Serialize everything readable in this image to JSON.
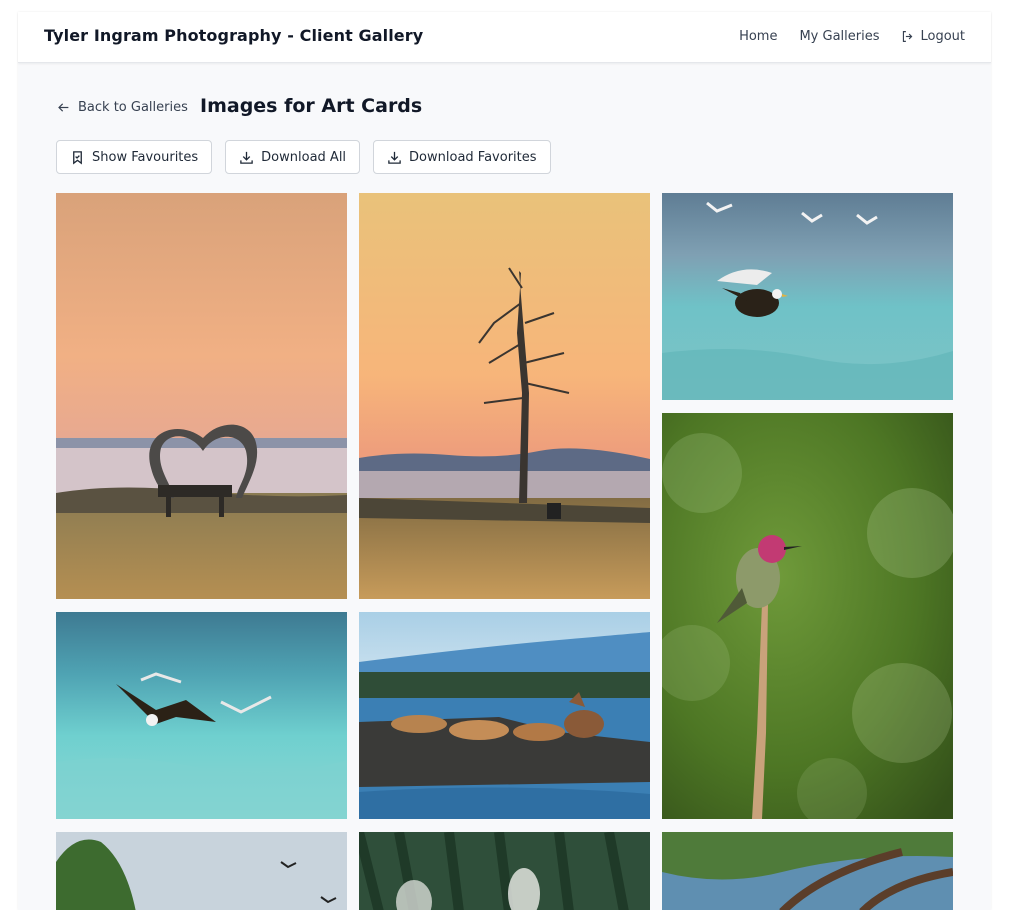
{
  "header": {
    "brand": "Tyler Ingram Photography - Client Gallery",
    "nav": {
      "home": "Home",
      "galleries": "My Galleries",
      "logout": "Logout"
    }
  },
  "page": {
    "back_label": "Back to Galleries",
    "title": "Images for Art Cards"
  },
  "toolbar": {
    "show_favourites": "Show Favourites",
    "download_all": "Download All",
    "download_favorites": "Download Favorites"
  },
  "gallery": {
    "photos": [
      {
        "subject": "driftwood heart and bench at sunset"
      },
      {
        "subject": "bare dead tree at sunset"
      },
      {
        "subject": "bald eagle with gulls over sea"
      },
      {
        "subject": "anna's hummingbird on branch"
      },
      {
        "subject": "bald eagle over turquoise water"
      },
      {
        "subject": "sea lions on rock"
      },
      {
        "subject": "birds over trees"
      },
      {
        "subject": "whale spouts by forest"
      },
      {
        "subject": "tree branches over water"
      }
    ]
  },
  "colors": {
    "accent": "#111827",
    "page_bg": "#f8f9fb",
    "border": "#d1d5db"
  }
}
